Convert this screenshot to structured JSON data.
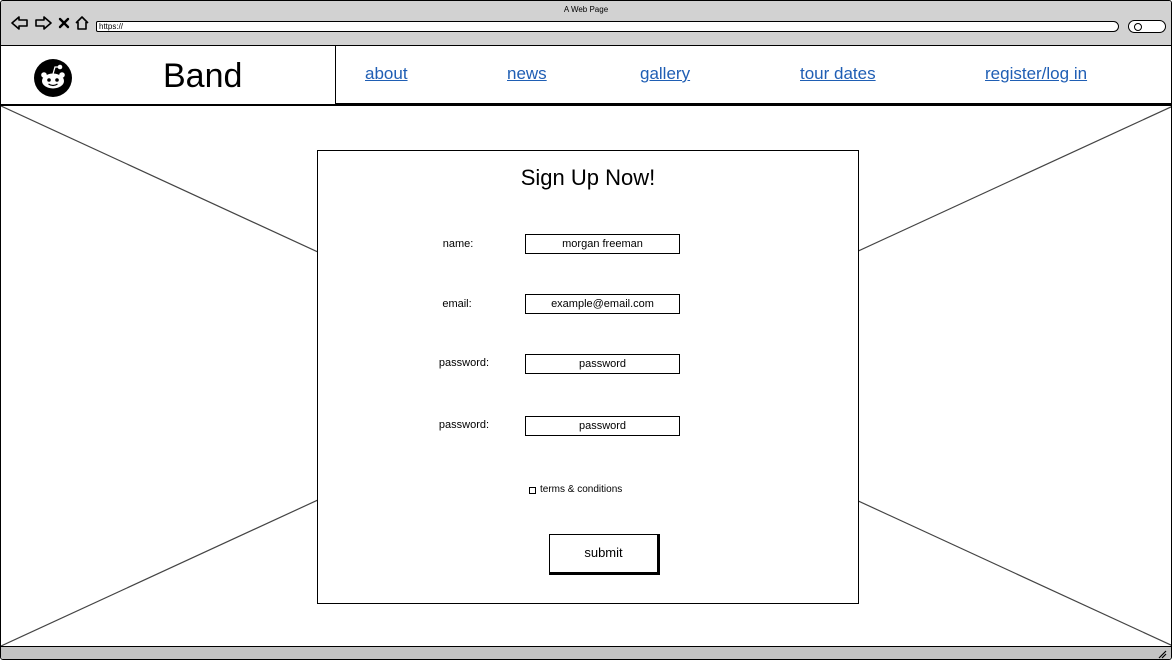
{
  "window": {
    "title": "A Web Page",
    "address": "https://"
  },
  "icons": {
    "back": "back-arrow-icon",
    "forward": "forward-arrow-icon",
    "stop": "close-icon",
    "home": "home-icon",
    "search": "search-icon",
    "logo": "alien-logo-icon"
  },
  "header": {
    "brand": "Band",
    "nav": {
      "about": "about",
      "news": "news",
      "gallery": "gallery",
      "tour_dates": "tour dates",
      "register": "register/log in"
    },
    "link_color": "#1f5eb4"
  },
  "form": {
    "title": "Sign Up Now!",
    "name_label": "name:",
    "name_value": "morgan freeman",
    "email_label": "email:",
    "email_value": "example@email.com",
    "password_label": "password:",
    "password_value": "password",
    "password2_label": "password:",
    "password2_value": "password",
    "terms_label": "terms & conditions",
    "submit_label": "submit"
  }
}
